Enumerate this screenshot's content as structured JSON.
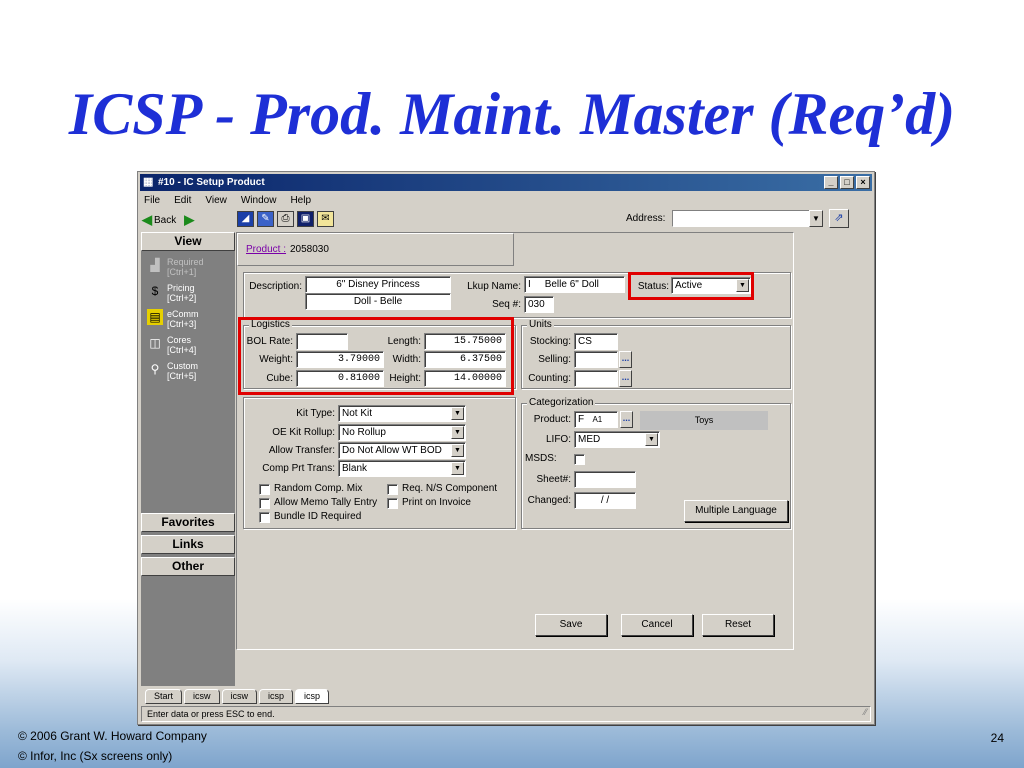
{
  "slide": {
    "title": "ICSP - Prod. Maint. Master (Req’d)",
    "footer_line1": "©  2006 Grant W. Howard Company",
    "footer_line2": "©  Infor, Inc (Sx screens only)",
    "page_number": "24"
  },
  "window": {
    "title": "#10 - IC Setup Product",
    "controls": {
      "minimize": "_",
      "maximize": "□",
      "close": "×"
    }
  },
  "menu": {
    "file": "File",
    "edit": "Edit",
    "view": "View",
    "window": "Window",
    "help": "Help"
  },
  "toolbar": {
    "back": "Back",
    "address_label": "Address:",
    "address_value": ""
  },
  "nav": {
    "view_tab": "View",
    "items": [
      {
        "label": "Required",
        "shortcut": "[Ctrl+1]",
        "icon": "required-icon"
      },
      {
        "label": "Pricing",
        "shortcut": "[Ctrl+2]",
        "icon": "pricing-icon"
      },
      {
        "label": "eComm",
        "shortcut": "[Ctrl+3]",
        "icon": "ecomm-icon"
      },
      {
        "label": "Cores",
        "shortcut": "[Ctrl+4]",
        "icon": "cores-icon"
      },
      {
        "label": "Custom",
        "shortcut": "[Ctrl+5]",
        "icon": "custom-icon"
      }
    ],
    "favorites_tab": "Favorites",
    "links_tab": "Links",
    "other_tab": "Other"
  },
  "product": {
    "link_label": "Product :",
    "value": "2058030"
  },
  "header": {
    "description_label": "Description:",
    "description_line1": "6\" Disney Princess",
    "description_line2": "Doll - Belle",
    "lookup_label": "Lkup Name:",
    "lookup_prefix": "I",
    "lookup_value": "Belle 6\" Doll",
    "seq_label": "Seq #:",
    "seq_value": "030",
    "status_label": "Status:",
    "status_value": "Active"
  },
  "logistics": {
    "legend": "Logistics",
    "bol_rate_label": "BOL Rate:",
    "bol_rate": "",
    "weight_label": "Weight:",
    "weight": "3.79000",
    "cube_label": "Cube:",
    "cube": "0.81000",
    "length_label": "Length:",
    "length": "15.75000",
    "width_label": "Width:",
    "width": "6.37500",
    "height_label": "Height:",
    "height": "14.00000"
  },
  "units": {
    "legend": "Units",
    "stocking_label": "Stocking:",
    "stocking": "CS",
    "selling_label": "Selling:",
    "selling": "",
    "counting_label": "Counting:",
    "counting": ""
  },
  "kit": {
    "kit_type_label": "Kit Type:",
    "kit_type": "Not Kit",
    "oe_kit_rollup_label": "OE Kit Rollup:",
    "oe_kit_rollup": "No Rollup",
    "allow_transfer_label": "Allow Transfer:",
    "allow_transfer": "Do Not Allow WT BOD",
    "comp_prt_trans_label": "Comp Prt Trans:",
    "comp_prt_trans": "Blank",
    "random_comp_mix": "Random Comp. Mix",
    "allow_memo_tally": "Allow Memo Tally Entry",
    "bundle_id_required": "Bundle ID Required",
    "req_ns_component": "Req. N/S Component",
    "print_on_invoice": "Print on Invoice"
  },
  "categorization": {
    "legend": "Categorization",
    "product_label": "Product:",
    "product_prefix": "F",
    "product_code": "A1",
    "product_desc": "Toys",
    "lifo_label": "LIFO:",
    "lifo": "MED",
    "msds_label": "MSDS:",
    "sheet_label": "Sheet#:",
    "sheet": "",
    "changed_label": "Changed:",
    "changed": "/   /",
    "multiple_language": "Multiple Language"
  },
  "actions": {
    "save": "Save",
    "cancel": "Cancel",
    "reset": "Reset"
  },
  "tasks": [
    "Start",
    "icsw",
    "icsw",
    "icsp",
    "icsp"
  ],
  "status_text": "Enter data or press ESC to end.",
  "colors": {
    "title_blue": "#1e2fd6",
    "highlight_red": "#e00000",
    "titlebar_dark": "#0a246a"
  }
}
